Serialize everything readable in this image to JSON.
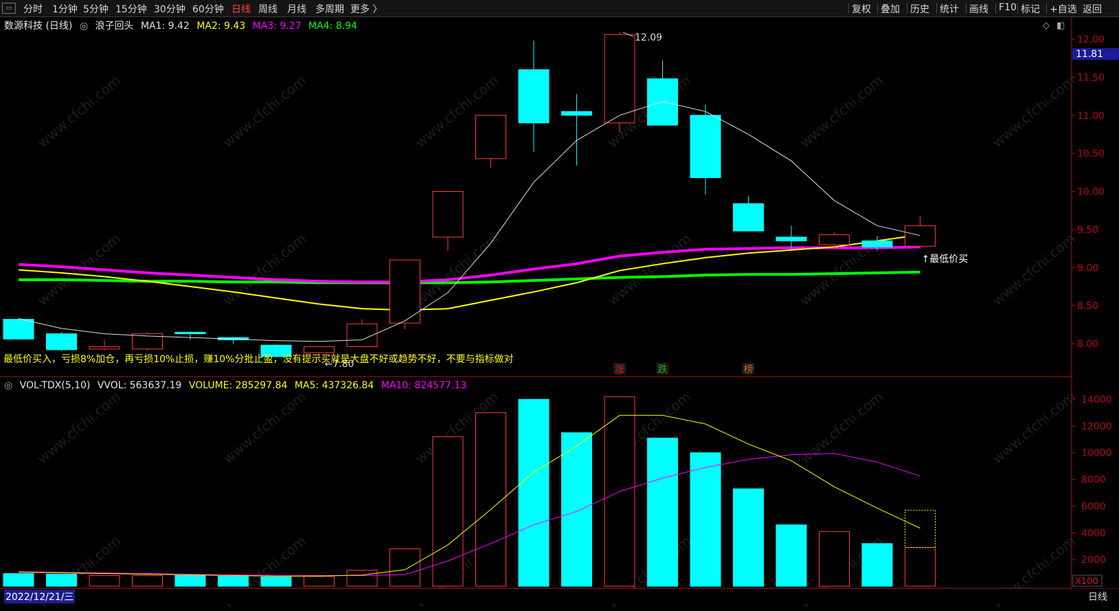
{
  "toolbar": {
    "left": [
      "分时",
      "1分钟",
      "5分钟",
      "15分钟",
      "30分钟",
      "60分钟",
      "日线",
      "周线",
      "月线",
      "多周期",
      "更多 〉"
    ],
    "active": "日线",
    "right": [
      "复权",
      "叠加",
      "历史",
      "统计",
      "画线",
      "F10",
      "标记",
      "+自选",
      "返回"
    ]
  },
  "info": {
    "stock": "数源科技 (日线)",
    "indicator": "浪子回头",
    "ma1": "MA1: 9.42",
    "ma2": "MA2: 9.43",
    "ma3": "MA3: 9.27",
    "ma4": "MA4: 8.94"
  },
  "vol_info": {
    "name": "VOL-TDX(5,10)",
    "vvol": "VVOL: 563637.19",
    "volume": "VOLUME: 285297.84",
    "ma5": "MA5: 437326.84",
    "ma10": "MA10: 824577.13"
  },
  "annotations": {
    "high_label": "12.09",
    "low_label": "7.80",
    "buy_label": "↑最低价买",
    "strategy_text": "最低价买入，亏损8%加仓，再亏损10%止损，赚10%分批止盈，没有提示买就是大盘不好或趋势不好，不要与指标做对",
    "mark_zhang": "涨",
    "mark_die": "跌",
    "mark_bang": "榜",
    "current_price": "11.81",
    "vol_unit": "X100"
  },
  "status": {
    "date": "2022/12/21/三",
    "mode": "日线",
    "month_marker": "1"
  },
  "watermark": "www.cfchi.com",
  "colors": {
    "up": "#ff3c3c",
    "down": "#00ffff",
    "ma1": "#e0e0e0",
    "ma2": "#ffff00",
    "ma3": "#ff00ff",
    "ma4": "#00ff00",
    "axis": "#b01010"
  },
  "chart_data": {
    "type": "candlestick",
    "price_axis": {
      "ylim": [
        7.7,
        12.1
      ],
      "ticks": [
        8.0,
        8.5,
        9.0,
        9.5,
        10.0,
        10.5,
        11.0,
        11.5,
        12.0
      ]
    },
    "candles": [
      {
        "open": 8.32,
        "close": 8.06,
        "high": 8.33,
        "low": 8.05
      },
      {
        "open": 8.13,
        "close": 7.92,
        "high": 8.15,
        "low": 7.9
      },
      {
        "open": 7.93,
        "close": 7.96,
        "high": 8.05,
        "low": 7.91
      },
      {
        "open": 7.93,
        "close": 8.13,
        "high": 8.15,
        "low": 7.91
      },
      {
        "open": 8.15,
        "close": 8.13,
        "high": 8.16,
        "low": 8.05
      },
      {
        "open": 8.08,
        "close": 8.05,
        "high": 8.09,
        "low": 8.0
      },
      {
        "open": 7.98,
        "close": 7.83,
        "high": 7.99,
        "low": 7.82
      },
      {
        "open": 7.88,
        "close": 7.96,
        "high": 7.97,
        "low": 7.8
      },
      {
        "open": 7.96,
        "close": 8.26,
        "high": 8.32,
        "low": 7.95
      },
      {
        "open": 8.27,
        "close": 9.1,
        "high": 9.1,
        "low": 8.19
      },
      {
        "open": 9.4,
        "close": 10.0,
        "high": 10.0,
        "low": 9.22
      },
      {
        "open": 10.43,
        "close": 11.0,
        "high": 11.0,
        "low": 10.31
      },
      {
        "open": 11.6,
        "close": 10.9,
        "high": 11.98,
        "low": 10.52
      },
      {
        "open": 11.05,
        "close": 11.0,
        "high": 11.28,
        "low": 10.34
      },
      {
        "open": 10.9,
        "close": 12.06,
        "high": 12.09,
        "low": 10.77
      },
      {
        "open": 11.48,
        "close": 10.87,
        "high": 11.72,
        "low": 10.87
      },
      {
        "open": 11.0,
        "close": 10.18,
        "high": 11.14,
        "low": 9.96
      },
      {
        "open": 9.84,
        "close": 9.48,
        "high": 9.94,
        "low": 9.48
      },
      {
        "open": 9.4,
        "close": 9.35,
        "high": 9.55,
        "low": 9.24
      },
      {
        "open": 9.3,
        "close": 9.43,
        "high": 9.46,
        "low": 9.25
      },
      {
        "open": 9.35,
        "close": 9.27,
        "high": 9.41,
        "low": 9.22
      },
      {
        "open": 9.28,
        "close": 9.55,
        "high": 9.67,
        "low": 9.27
      }
    ],
    "ma1": [
      8.33,
      8.2,
      8.13,
      8.1,
      8.08,
      8.06,
      8.04,
      8.03,
      8.05,
      8.3,
      8.67,
      9.32,
      10.12,
      10.67,
      11.0,
      11.18,
      11.05,
      10.75,
      10.4,
      9.88,
      9.55,
      9.42
    ],
    "ma2": [
      8.97,
      8.93,
      8.88,
      8.82,
      8.75,
      8.68,
      8.6,
      8.52,
      8.46,
      8.44,
      8.46,
      8.57,
      8.68,
      8.8,
      8.96,
      9.05,
      9.13,
      9.19,
      9.23,
      9.27,
      9.35,
      9.43
    ],
    "ma3": [
      9.04,
      9.01,
      8.97,
      8.93,
      8.9,
      8.87,
      8.84,
      8.82,
      8.81,
      8.81,
      8.84,
      8.9,
      8.98,
      9.05,
      9.15,
      9.2,
      9.24,
      9.25,
      9.26,
      9.26,
      9.26,
      9.27
    ],
    "ma4": [
      8.84,
      8.84,
      8.83,
      8.82,
      8.82,
      8.81,
      8.81,
      8.8,
      8.8,
      8.8,
      8.8,
      8.81,
      8.83,
      8.85,
      8.87,
      8.88,
      8.9,
      8.91,
      8.91,
      8.92,
      8.93,
      8.94
    ],
    "volume_axis": {
      "ylim": [
        0,
        14500
      ],
      "ticks": [
        2000,
        4000,
        6000,
        8000,
        10000,
        12000,
        14000
      ]
    },
    "volume": [
      950,
      900,
      800,
      800,
      800,
      750,
      700,
      750,
      1200,
      2800,
      11200,
      13000,
      14000,
      11500,
      14200,
      11100,
      10000,
      7300,
      4600,
      4100,
      3200,
      2900
    ],
    "volume_ghost_last": 5700,
    "vol_ma5": [
      1050,
      1000,
      950,
      900,
      850,
      800,
      760,
      760,
      840,
      1240,
      3100,
      5750,
      8550,
      10500,
      12800,
      12800,
      12150,
      10650,
      9400,
      7450,
      5850,
      4350
    ],
    "vol_ma10": [
      1100,
      1050,
      1000,
      950,
      900,
      860,
      820,
      800,
      800,
      870,
      1900,
      3200,
      4600,
      5600,
      7100,
      8100,
      8900,
      9500,
      9850,
      9950,
      9300,
      8250
    ]
  }
}
